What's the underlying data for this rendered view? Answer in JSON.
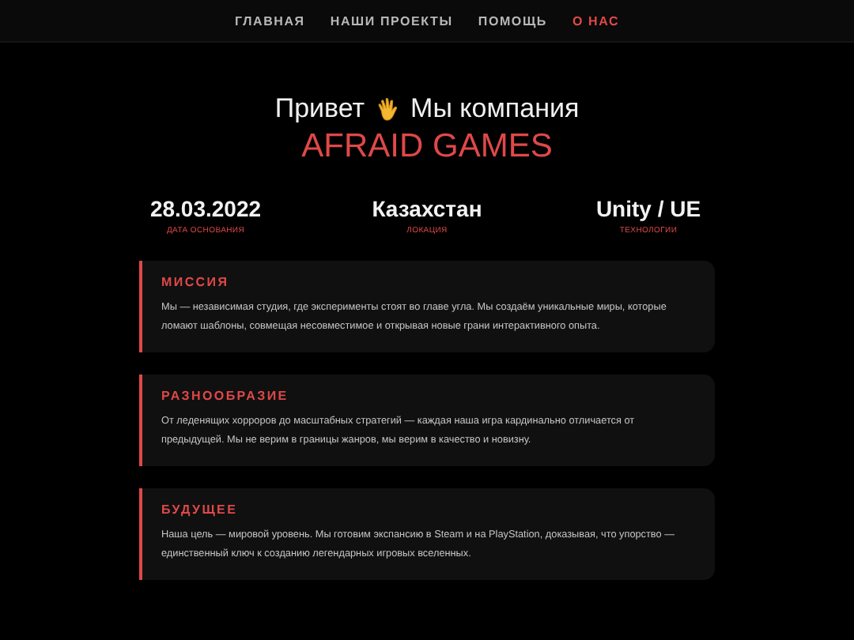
{
  "nav": [
    {
      "label": "ГЛАВНАЯ",
      "selected": false
    },
    {
      "label": "НАШИ ПРОЕКТЫ",
      "selected": false
    },
    {
      "label": "ПОМОЩЬ",
      "selected": false
    },
    {
      "label": "О НАС",
      "selected": true
    }
  ],
  "hero": {
    "greeting": "Привет",
    "tagline": "Мы компания",
    "brand": "AFRAID GAMES"
  },
  "stats": [
    {
      "value": "28.03.2022",
      "label": "ДАТА ОСНОВАНИЯ"
    },
    {
      "value": "Казахстан",
      "label": "ЛОКАЦИЯ"
    },
    {
      "value": "Unity / UE",
      "label": "ТЕХНОЛОГИИ"
    }
  ],
  "cards": [
    {
      "title": "МИССИЯ",
      "text": "Мы — независимая студия, где эксперименты стоят во главе угла. Мы создаём уникальные миры, которые ломают шаблоны, совмещая несовместимое и открывая новые грани интерактивного опыта."
    },
    {
      "title": "РАЗНООБРАЗИЕ",
      "text": "От леденящих хорроров до масштабных стратегий — каждая наша игра кардинально отличается от предыдущей. Мы не верим в границы жанров, мы верим в качество и новизну."
    },
    {
      "title": "БУДУЩЕЕ",
      "text": "Наша цель — мировой уровень. Мы готовим экспансию в Steam и на PlayStation, доказывая, что упорство — единственный ключ к созданию легендарных игровых вселенных."
    }
  ]
}
